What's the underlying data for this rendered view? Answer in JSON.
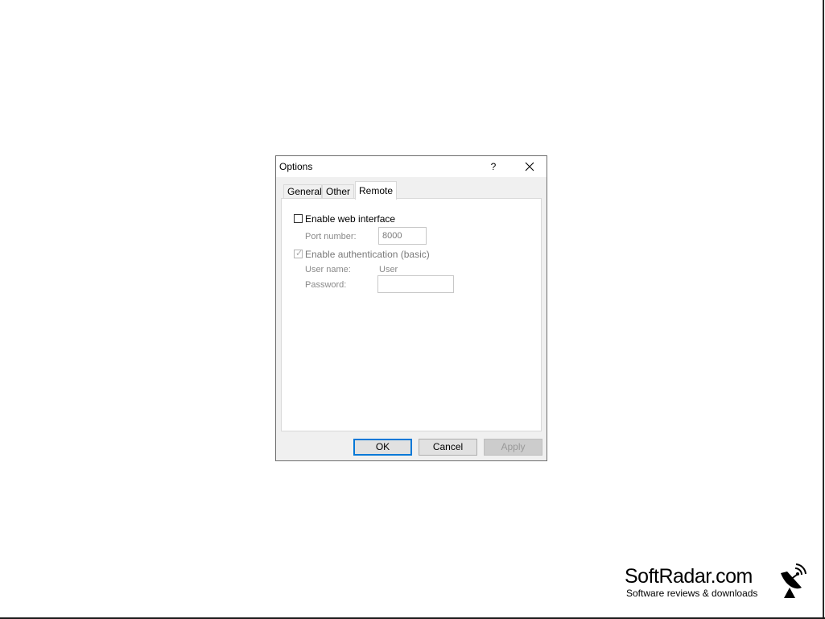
{
  "dialog": {
    "title": "Options",
    "help_glyph": "?",
    "close_glyph": "✕"
  },
  "tabs": [
    {
      "label": "General",
      "active": false
    },
    {
      "label": "Other",
      "active": false
    },
    {
      "label": "Remote",
      "active": true
    }
  ],
  "remote": {
    "enable_web_interface": {
      "label": "Enable web interface",
      "checked": false
    },
    "port_number": {
      "label": "Port number:",
      "value": "8000"
    },
    "enable_authentication": {
      "label": "Enable authentication (basic)",
      "checked": true
    },
    "user_name": {
      "label": "User name:",
      "value": "User"
    },
    "password": {
      "label": "Password:",
      "value": ""
    }
  },
  "buttons": {
    "ok": "OK",
    "cancel": "Cancel",
    "apply": "Apply"
  },
  "watermark": {
    "title": "SoftRadar.com",
    "subtitle": "Software reviews & downloads"
  },
  "colors": {
    "accent": "#0078d7",
    "dialog_bg": "#f0f0f0",
    "disabled_text": "#8a8a8a"
  }
}
